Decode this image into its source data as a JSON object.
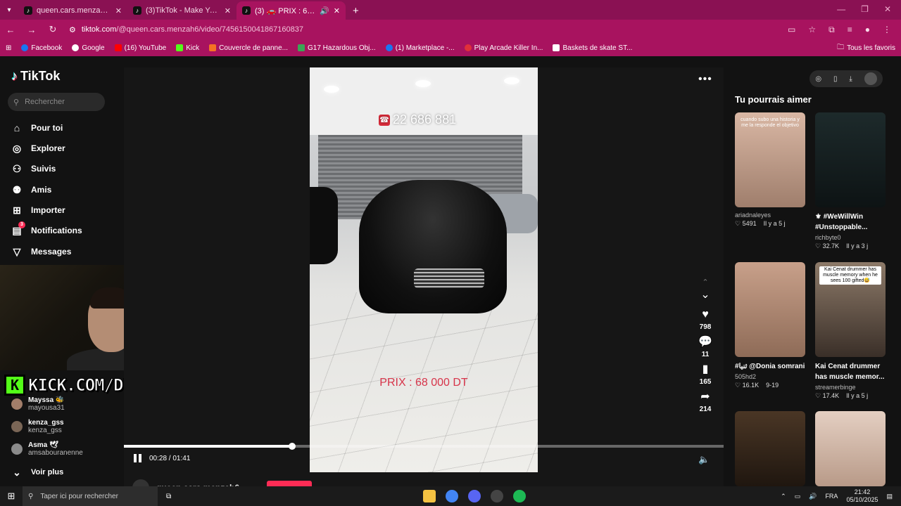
{
  "browser": {
    "tabs": [
      {
        "title": "queen.cars.menzah6 (@queen.c",
        "active": false
      },
      {
        "title": "(3)TikTok - Make Your Day",
        "active": false
      },
      {
        "title": "(3) 🚗 PRIX : 68 000 DT 🚗",
        "active": true
      }
    ],
    "url_host": "tiktok.com",
    "url_path": "/@queen.cars.menzah6/video/7456150041867160837",
    "bookmarks": [
      "Facebook",
      "Google",
      "(16) YouTube",
      "Kick",
      "Couvercle de panne...",
      "G17 Hazardous Obj...",
      "(1) Marketplace -...",
      "Play Arcade Killer In...",
      "Baskets de skate ST..."
    ],
    "bookmarks_folder": "Tous les favoris"
  },
  "sidebar": {
    "logo": "TikTok",
    "search_placeholder": "Rechercher",
    "nav": [
      "Pour toi",
      "Explorer",
      "Suivis",
      "Amis",
      "Importer",
      "Notifications",
      "Messages"
    ],
    "notifications_badge": "3",
    "following": [
      {
        "name": "Mayssa 🐝",
        "handle": "mayousa31"
      },
      {
        "name": "kenza_gss",
        "handle": "kenza_gss"
      },
      {
        "name": "Asma 🕊",
        "handle": "amsabouranenne"
      }
    ],
    "more": "Voir plus"
  },
  "stream_overlay": {
    "kick_letter": "K",
    "kick_text": "KICK.COM/DUNGAA"
  },
  "video": {
    "phone": "22 686 881",
    "price": "PRIX : 68 000 DT",
    "likes": "798",
    "comments": "11",
    "saves": "165",
    "shares": "214",
    "elapsed": "00:28",
    "duration": "01:41",
    "time_display": "00:28 / 01:41",
    "progress": 0.28,
    "author": "queen.cars.menzah6"
  },
  "recommendations": {
    "title": "Tu pourrais aimer",
    "items": [
      {
        "caption": "cuando subo una historia y me la responde el objetivo",
        "title": "",
        "user": "ariadnaleyes",
        "likes": "5491",
        "age": "Il y a 5 j",
        "color": "#c9a48f"
      },
      {
        "caption": "",
        "title": "⚜ #WeWillWin #Unstoppable...",
        "user": "richbyte0",
        "likes": "32.7K",
        "age": "Il y a 3 j",
        "color": "#1e2a2a"
      },
      {
        "caption": "",
        "title": "#ثنيا @Donia somrani",
        "user": "505hd2",
        "likes": "16.1K",
        "age": "9-19",
        "color": "#c49a80"
      },
      {
        "caption": "Kai Cenat drummer has muscle memory when he sees 100 gifted😅",
        "title": "Kai Cenat drummer has muscle memor...",
        "user": "streamerbinge",
        "likes": "17.4K",
        "age": "Il y a 5 j",
        "color": "#6e5a4a"
      },
      {
        "caption": "",
        "title": "",
        "user": "",
        "likes": "",
        "age": "",
        "color": "#3b2a1c"
      },
      {
        "caption": "",
        "title": "",
        "user": "",
        "likes": "",
        "age": "",
        "color": "#d8c0b0"
      }
    ]
  },
  "taskbar": {
    "search_placeholder": "Taper ici pour rechercher",
    "lang": "FRA",
    "time": "21:42",
    "date": "05/10/2025"
  }
}
